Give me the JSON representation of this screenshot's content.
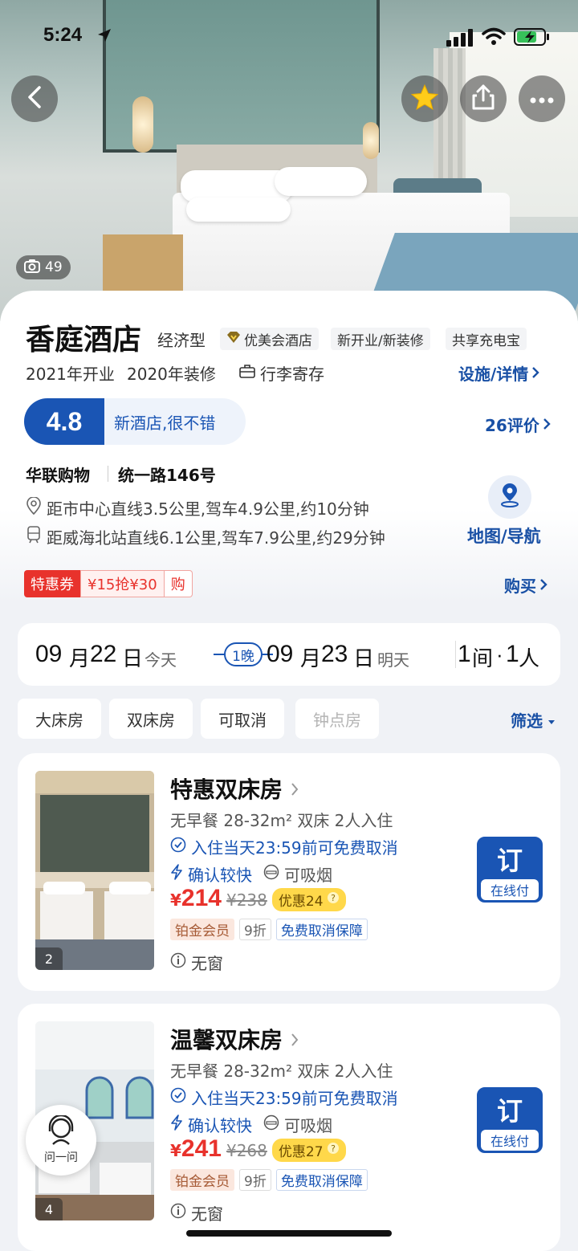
{
  "status_bar": {
    "time": "5:24"
  },
  "hero": {
    "photo_count": "49"
  },
  "hotel": {
    "name": "香庭酒店",
    "tags": [
      "经济型",
      "优美会酒店",
      "新开业/新装修",
      "共享充电宝"
    ],
    "opened": "2021年开业",
    "renovated": "2020年装修",
    "luggage": "行李寄存",
    "facilities_link": "设施/详情",
    "rating": "4.8",
    "rating_text": "新酒店,很不错",
    "reviews_link": "26评价",
    "area": "华联购物",
    "address": "统一路146号",
    "distance_center": "距市中心直线3.5公里,驾车4.9公里,约10分钟",
    "distance_station": "距威海北站直线6.1公里,驾车7.9公里,约29分钟",
    "map_link": "地图/导航",
    "coupon": {
      "label": "特惠券",
      "offer": "¥15抢¥30",
      "action": "购"
    },
    "buy_link": "购买"
  },
  "booking": {
    "checkin_month": "09",
    "checkin_day": "22",
    "checkin_sub": "今天",
    "nights": "1晚",
    "checkout_month": "09",
    "checkout_day": "23",
    "checkout_sub": "明天",
    "rooms": "1",
    "guests": "1",
    "month_unit": "月",
    "day_unit": "日",
    "room_unit": "间",
    "guest_unit": "人"
  },
  "filters": {
    "chips": [
      "大床房",
      "双床房",
      "可取消",
      "钟点房"
    ],
    "filter_link": "筛选"
  },
  "rooms": [
    {
      "name": "特惠双床房",
      "specs": "无早餐  28-32m²  双床  2人入住",
      "cancel": "入住当天23:59前可免费取消",
      "confirm": "确认较快",
      "smoking": "可吸烟",
      "currency": "¥",
      "price": "214",
      "original_price": "¥238",
      "discount": "优惠24",
      "member": "铂金会员",
      "member_discount": "9折",
      "guarantee": "免费取消保障",
      "window": "无窗",
      "photo_count": "2",
      "book_label": "订",
      "book_sub": "在线付"
    },
    {
      "name": "温馨双床房",
      "specs": "无早餐  28-32m²  双床  2人入住",
      "cancel": "入住当天23:59前可免费取消",
      "confirm": "确认较快",
      "smoking": "可吸烟",
      "currency": "¥",
      "price": "241",
      "original_price": "¥268",
      "discount": "优惠27",
      "member": "铂金会员",
      "member_discount": "9折",
      "guarantee": "免费取消保障",
      "window": "无窗",
      "photo_count": "4",
      "book_label": "订",
      "book_sub": "在线付"
    }
  ],
  "ask": {
    "label": "问一问"
  },
  "colors": {
    "brand_blue": "#1a55b4",
    "price_red": "#e8322c",
    "discount_yellow": "#ffd84a"
  }
}
